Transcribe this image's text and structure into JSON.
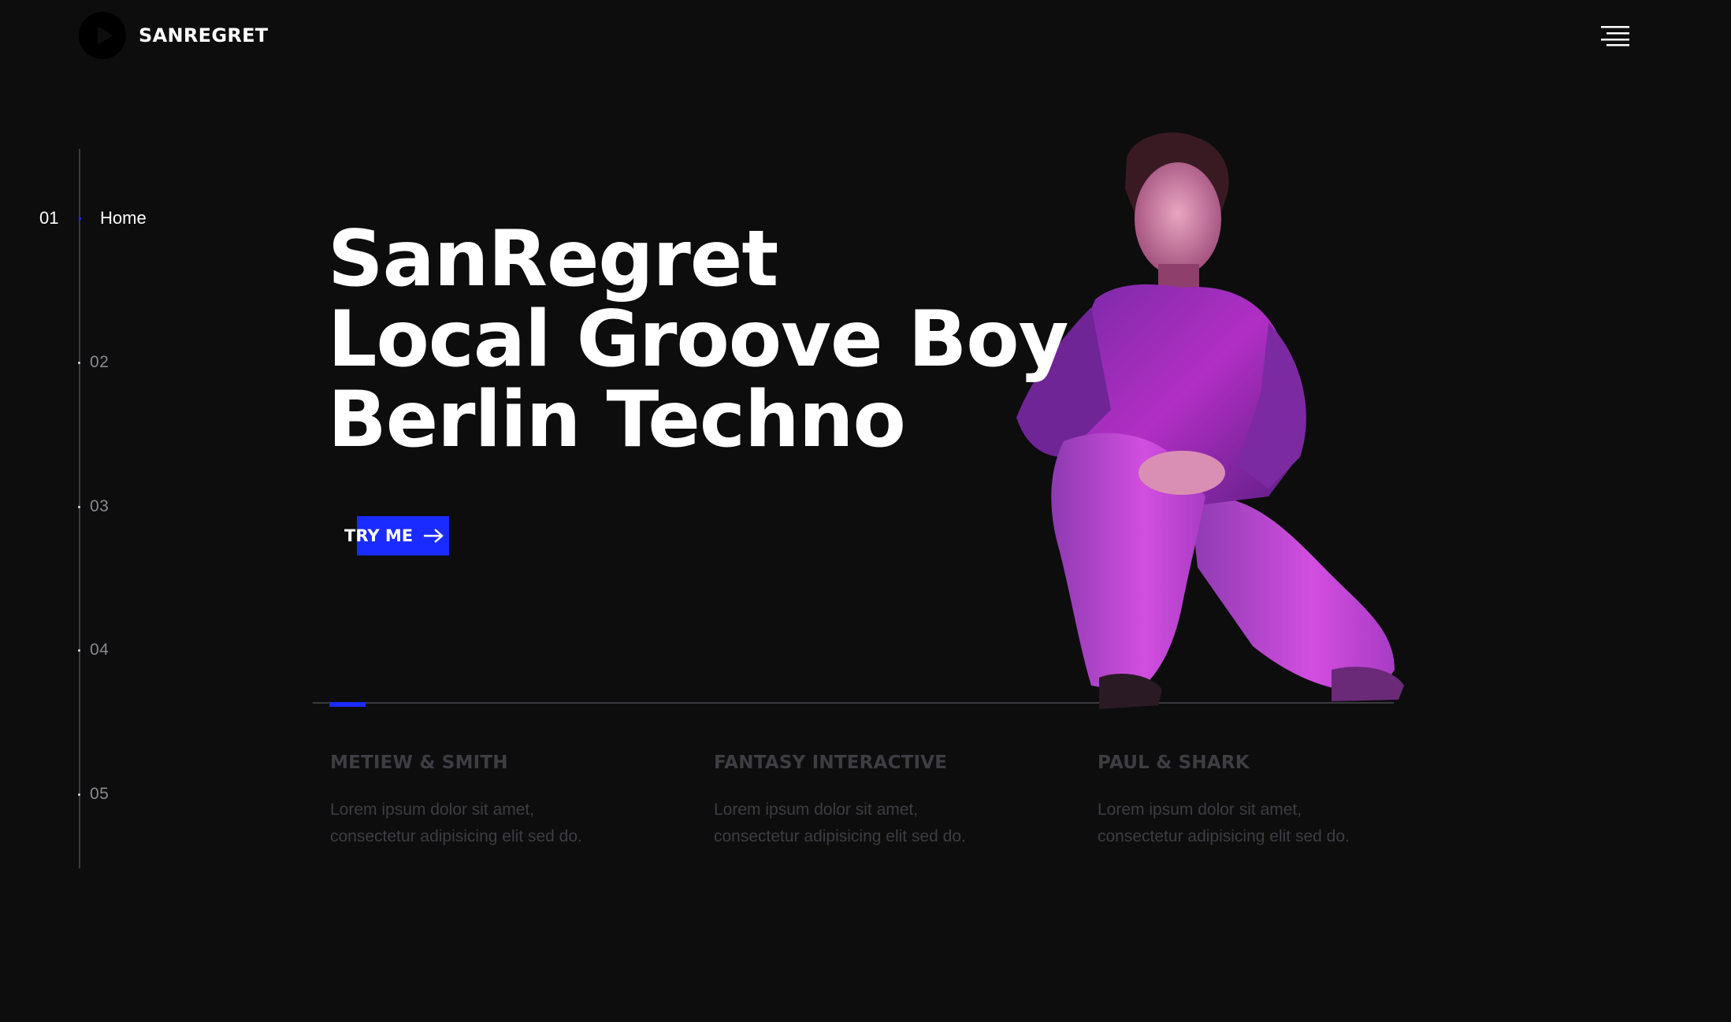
{
  "brand": {
    "name": "SANREGRET",
    "icon": "play-icon"
  },
  "header": {
    "menu_icon": "hamburger-menu-icon"
  },
  "side_nav": {
    "active": {
      "number": "01",
      "label": "Home"
    },
    "items": [
      {
        "number": "02"
      },
      {
        "number": "03"
      },
      {
        "number": "04"
      },
      {
        "number": "05"
      }
    ]
  },
  "hero": {
    "line1": "SanRegret",
    "line2": "Local Groove Boy",
    "line3": "Berlin Techno",
    "cta_label": "TRY ME",
    "cta_icon": "arrow-right-icon"
  },
  "clients": [
    {
      "name": "METIEW & SMITH",
      "line1": "Lorem ipsum dolor sit amet,",
      "line2": "consectetur adipisicing elit sed do."
    },
    {
      "name": "FANTASY INTERACTIVE",
      "line1": "Lorem ipsum dolor sit amet,",
      "line2": "consectetur adipisicing elit sed do."
    },
    {
      "name": "PAUL & SHARK",
      "line1": "Lorem ipsum dolor sit amet,",
      "line2": "consectetur adipisicing elit sed do."
    }
  ],
  "colors": {
    "background": "#0d0d0e",
    "accent": "#1a2bff",
    "muted_text": "#3d3d42",
    "person_tint": "#c22bd0"
  }
}
